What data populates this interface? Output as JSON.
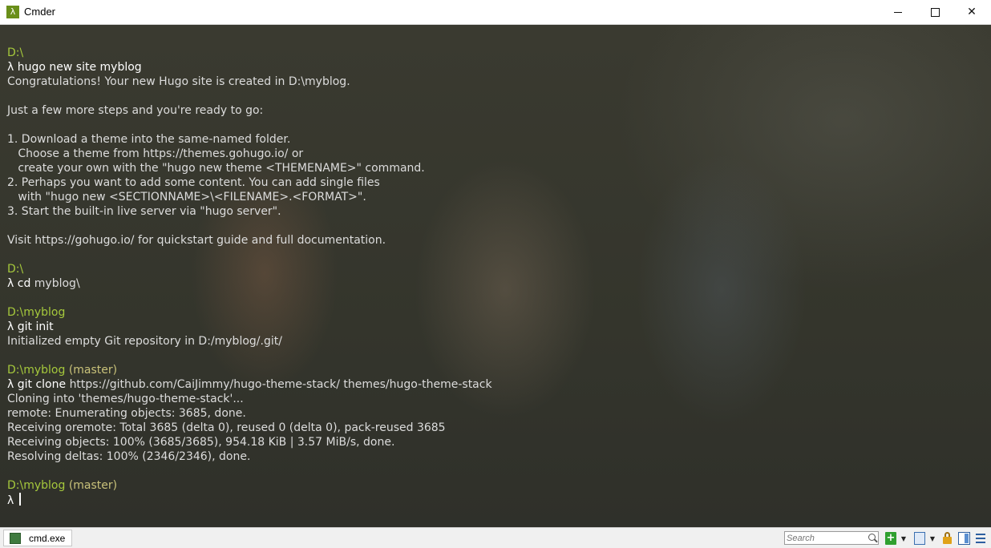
{
  "window": {
    "title": "Cmder",
    "app_icon_glyph": "λ",
    "controls": [
      "minimize",
      "maximize",
      "close"
    ]
  },
  "console": {
    "colors": {
      "path": "#a5c83c",
      "branch": "#c9c27a",
      "text": "#dcdcdc",
      "background": "#34352c"
    },
    "lines": [
      {
        "path": "D:\\"
      },
      {
        "prompt": "λ",
        "cmd": "hugo new site myblog"
      },
      {
        "text": "Congratulations! Your new Hugo site is created in D:\\myblog."
      },
      {
        "text": ""
      },
      {
        "text": "Just a few more steps and you're ready to go:"
      },
      {
        "text": ""
      },
      {
        "text": "1. Download a theme into the same-named folder."
      },
      {
        "text": "   Choose a theme from https://themes.gohugo.io/ or"
      },
      {
        "text": "   create your own with the \"hugo new theme <THEMENAME>\" command."
      },
      {
        "text": "2. Perhaps you want to add some content. You can add single files"
      },
      {
        "text": "   with \"hugo new <SECTIONNAME>\\<FILENAME>.<FORMAT>\"."
      },
      {
        "text": "3. Start the built-in live server via \"hugo server\"."
      },
      {
        "text": ""
      },
      {
        "text": "Visit https://gohugo.io/ for quickstart guide and full documentation."
      },
      {
        "text": ""
      },
      {
        "path": "D:\\"
      },
      {
        "prompt": "λ",
        "cmd": "cd",
        "args": "myblog\\"
      },
      {
        "text": ""
      },
      {
        "path": "D:\\myblog"
      },
      {
        "prompt": "λ",
        "cmd": "git init"
      },
      {
        "text": "Initialized empty Git repository in D:/myblog/.git/"
      },
      {
        "text": ""
      },
      {
        "path": "D:\\myblog",
        "branch": "(master)"
      },
      {
        "prompt": "λ",
        "cmd": "git clone",
        "args": "https://github.com/CaiJimmy/hugo-theme-stack/ themes/hugo-theme-stack"
      },
      {
        "text": "Cloning into 'themes/hugo-theme-stack'..."
      },
      {
        "text": "remote: Enumerating objects: 3685, done."
      },
      {
        "text": "Receiving oremote: Total 3685 (delta 0), reused 0 (delta 0), pack-reused 3685"
      },
      {
        "text": "Receiving objects: 100% (3685/3685), 954.18 KiB | 3.57 MiB/s, done."
      },
      {
        "text": "Resolving deltas: 100% (2346/2346), done."
      },
      {
        "text": ""
      },
      {
        "path": "D:\\myblog",
        "branch": "(master)"
      },
      {
        "prompt": "λ",
        "cmd": "",
        "cursor": true
      }
    ]
  },
  "statusbar": {
    "tab_label": "cmd.exe",
    "search_placeholder": "Search",
    "icons": [
      "new-console-plus-icon",
      "dropdown-arrow-icon",
      "split-view-icon",
      "dropdown-arrow-icon",
      "lock-icon",
      "panel-icon",
      "menu-icon"
    ],
    "dropdown_glyph": "▼",
    "plus_glyph": "+"
  }
}
